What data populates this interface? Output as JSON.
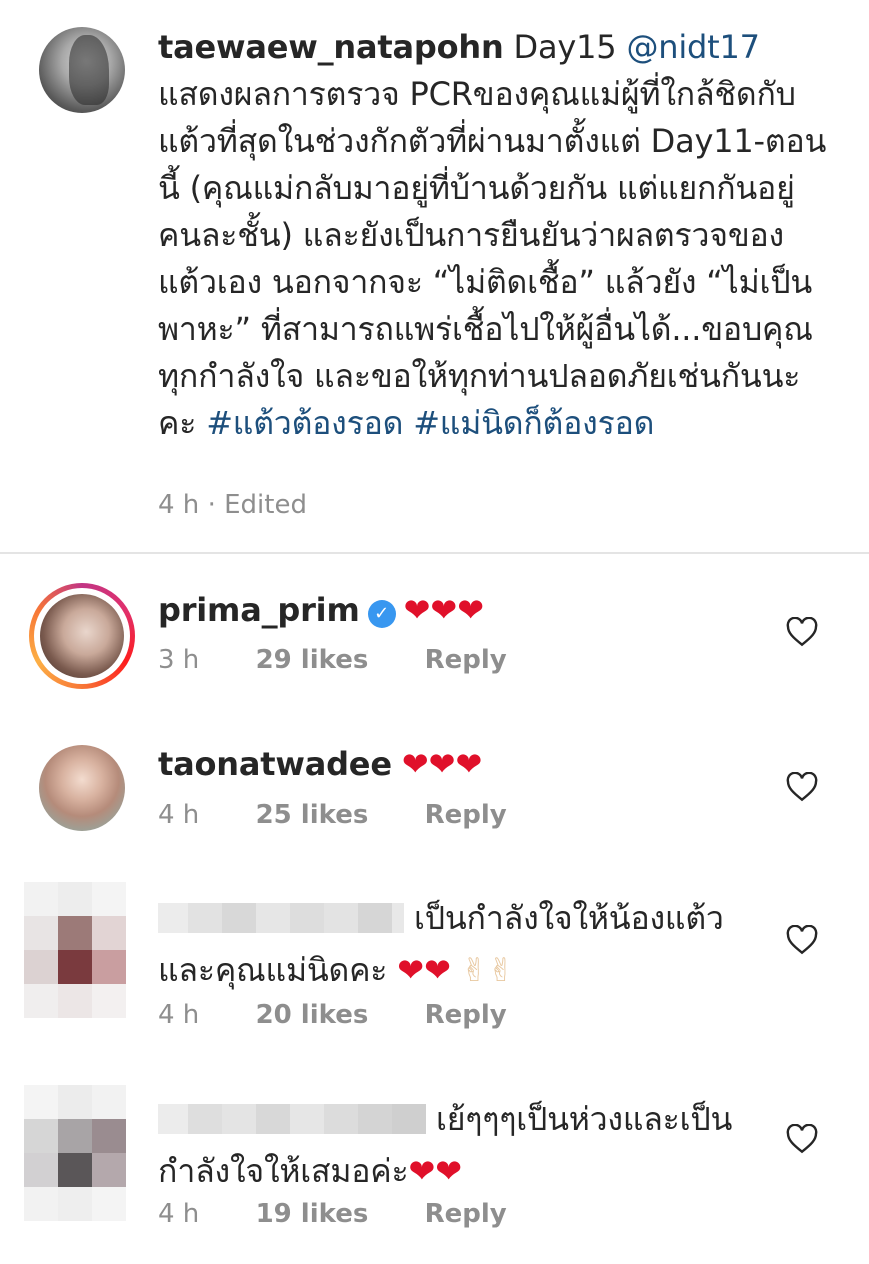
{
  "caption": {
    "username": "taewaew_natapohn",
    "text": "Day15",
    "mention": "@nidt17",
    "body": "แสดงผลการตรวจ PCRของคุณแม่ผู้ที่ใกล้ชิดกับแต้วที่สุดในช่วงกักตัวที่ผ่านมาตั้งแต่ Day11-ตอนนี้ (คุณแม่กลับมาอยู่ที่บ้านด้วยกัน แต่แยกกันอยู่คนละชั้น) และยังเป็นการยืนยันว่าผลตรวจของแต้วเอง นอกจากจะ “ไม่ติดเชื้อ” แล้วยัง “ไม่เป็นพาหะ” ที่สามารถแพร่เชื้อไปให้ผู้อื่นได้...ขอบคุณทุกกำลังใจ และขอให้ทุกท่านปลอดภัยเช่นกันนะคะ",
    "hashtag1": "#แต้วต้องรอด",
    "hashtag2": "#แม่นิดก็ต้องรอด",
    "time": "4 h",
    "separator": "·",
    "edited": "Edited"
  },
  "comments": [
    {
      "username": "prima_prim",
      "verified": true,
      "text": "❤❤❤",
      "time": "3 h",
      "likes": "29 likes",
      "reply": "Reply"
    },
    {
      "username": "taonatwadee",
      "verified": false,
      "text": "❤❤❤",
      "time": "4 h",
      "likes": "25 likes",
      "reply": "Reply"
    },
    {
      "username": "",
      "text_line1": "เป็นกำลังใจให้น้องแต้ว",
      "text_line2": "และคุณแม่นิดคะ",
      "hearts": "❤❤",
      "emoji": "✌✌",
      "time": "4 h",
      "likes": "20 likes",
      "reply": "Reply"
    },
    {
      "username": "",
      "text_line1": "เย้ๆๆๆเป็นห่วงและเป็น",
      "text_line2": "กำลังใจให้เสมอค่ะ",
      "hearts": "❤❤",
      "time": "4 h",
      "likes": "19 likes",
      "reply": "Reply"
    }
  ],
  "colors": {
    "link": "#1d4f7c",
    "heart": "#e0102a",
    "meta": "#8e8e8e",
    "verified": "#3897f0"
  },
  "icons": [
    "heart-outline-icon",
    "verified-badge-icon"
  ]
}
